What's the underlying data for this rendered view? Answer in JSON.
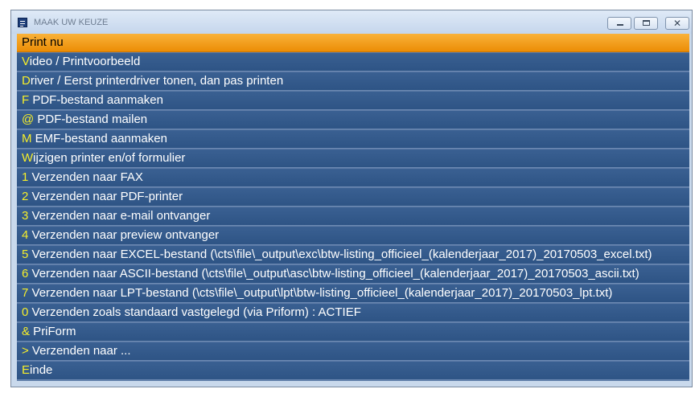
{
  "window": {
    "title": "MAAK UW KEUZE"
  },
  "accent_color": "#f29a10",
  "item_color": "#345a8c",
  "hotkey_color": "#f6ee2a",
  "icons": {
    "app": "menu-list-icon",
    "minimize": "minimize-icon",
    "maximize": "maximize-icon",
    "close": "close-icon"
  },
  "menu": {
    "items": [
      {
        "key": "P",
        "rest": "rint nu"
      },
      {
        "key": "V",
        "rest": "ideo / Printvoorbeeld"
      },
      {
        "key": "D",
        "rest": "river / Eerst printerdriver tonen, dan pas printen"
      },
      {
        "key": "F",
        "rest": " PDF-bestand aanmaken"
      },
      {
        "key": "@",
        "rest": " PDF-bestand mailen"
      },
      {
        "key": "M",
        "rest": " EMF-bestand aanmaken"
      },
      {
        "key": "W",
        "rest": "ijzigen printer en/of formulier"
      },
      {
        "key": "1",
        "rest": " Verzenden naar FAX"
      },
      {
        "key": "2",
        "rest": " Verzenden naar PDF-printer"
      },
      {
        "key": "3",
        "rest": " Verzenden naar e-mail ontvanger"
      },
      {
        "key": "4",
        "rest": " Verzenden naar preview ontvanger"
      },
      {
        "key": "5",
        "rest": " Verzenden naar EXCEL-bestand (\\cts\\file\\_output\\exc\\btw-listing_officieel_(kalenderjaar_2017)_20170503_excel.txt)"
      },
      {
        "key": "6",
        "rest": " Verzenden naar ASCII-bestand (\\cts\\file\\_output\\asc\\btw-listing_officieel_(kalenderjaar_2017)_20170503_ascii.txt)"
      },
      {
        "key": "7",
        "rest": " Verzenden naar LPT-bestand (\\cts\\file\\_output\\lpt\\btw-listing_officieel_(kalenderjaar_2017)_20170503_lpt.txt)"
      },
      {
        "key": "0",
        "rest": " Verzenden zoals standaard vastgelegd (via Priform) : ACTIEF"
      },
      {
        "key": "&",
        "rest": " PriForm"
      },
      {
        "key": ">",
        "rest": " Verzenden naar ..."
      },
      {
        "key": "E",
        "rest": "inde"
      }
    ]
  }
}
